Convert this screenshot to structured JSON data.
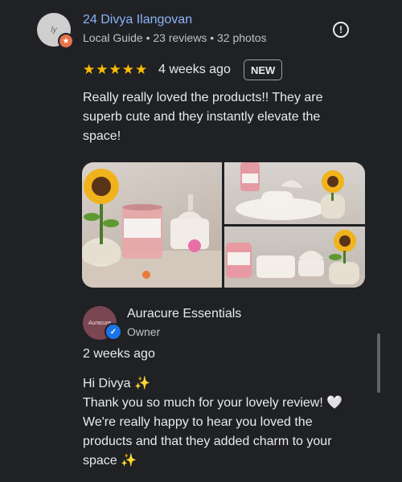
{
  "review": {
    "reviewer_name": "24 Divya Ilangovan",
    "reviewer_meta": "Local Guide • 23 reviews • 32 photos",
    "avatar_text": "ly",
    "stars": "★★★★★",
    "rating": 5,
    "time_ago": "4 weeks ago",
    "badge": "NEW",
    "text": "Really really loved the products!! They are superb cute and they instantly elevate the space!"
  },
  "owner_response": {
    "owner_name": "Auracure Essentials",
    "role": "Owner",
    "avatar_text": "Auracure",
    "time_ago": "2 weeks ago",
    "greeting": "Hi Divya ✨",
    "message": "Thank you so much for your lovely review! 🤍 We're really happy to hear you loved the products and that they added charm to your space ✨"
  },
  "colors": {
    "background": "#202124",
    "link": "#8ab4f8",
    "star": "#fbbc04",
    "verified": "#1a73e8"
  }
}
